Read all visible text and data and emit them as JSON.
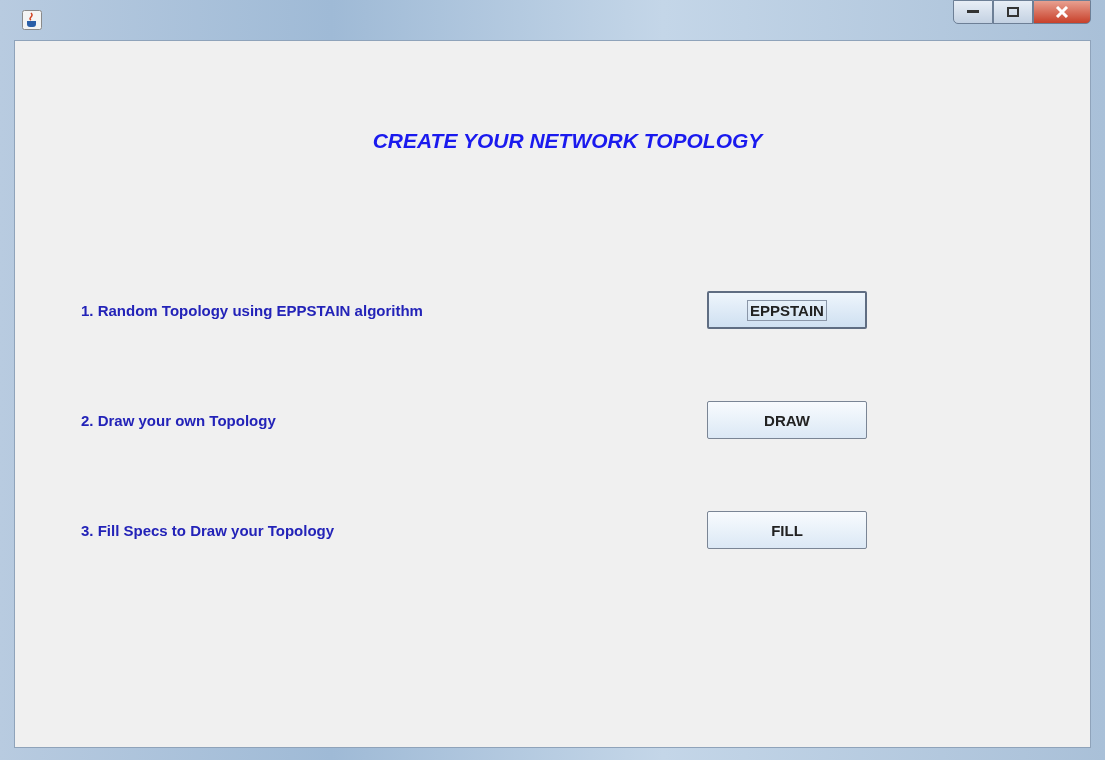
{
  "heading": "CREATE YOUR NETWORK TOPOLOGY",
  "options": [
    {
      "label": "1. Random Topology using EPPSTAIN algorithm",
      "button": "EPPSTAIN",
      "focused": true
    },
    {
      "label": "2. Draw your own Topology",
      "button": "DRAW",
      "focused": false
    },
    {
      "label": "3. Fill Specs to Draw your Topology",
      "button": "FILL",
      "focused": false
    }
  ]
}
